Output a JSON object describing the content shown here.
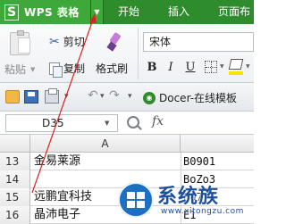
{
  "app": {
    "wps_button": "WPS 表格",
    "logo_letter": "S"
  },
  "menu": {
    "items": [
      "开始",
      "插入",
      "页面布"
    ]
  },
  "ribbon": {
    "paste_label": "粘贴",
    "cut_label": "剪切",
    "copy_label": "复制",
    "format_painter_label": "格式刷",
    "font_name": "宋体",
    "bold": "B",
    "italic": "I",
    "underline": "U"
  },
  "quickbar": {
    "docer_label": "Docer-在线模板"
  },
  "formula_bar": {
    "name_box": "D35",
    "fx": "fx"
  },
  "grid": {
    "column_a": "A",
    "rows": [
      {
        "num": "13",
        "a": "金易莱源",
        "b": "B0901"
      },
      {
        "num": "14",
        "a": "",
        "b": "BoZo3"
      },
      {
        "num": "15",
        "a": "远鹏宜科技",
        "b": "B07"
      },
      {
        "num": "16",
        "a": "晶沛电子",
        "b": "E1"
      }
    ]
  },
  "watermark": {
    "title": "系统族",
    "url": "www.xitongzu.com"
  },
  "colors": {
    "title_green": "#2f8c2c",
    "wps_button_green": "#3ea93a",
    "annotation_red": "#e02020"
  }
}
